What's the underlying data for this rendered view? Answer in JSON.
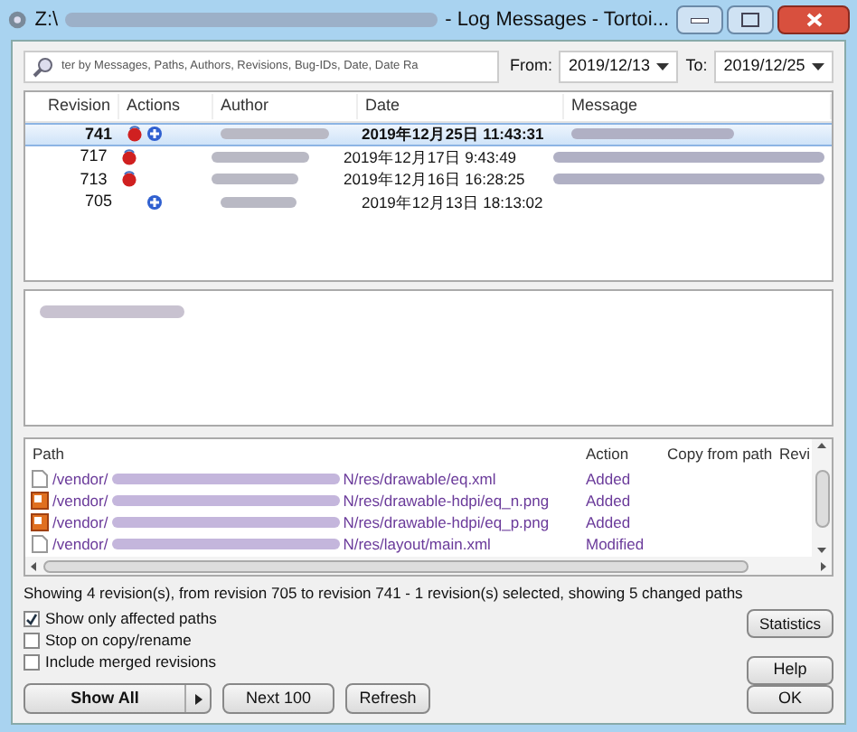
{
  "window": {
    "title_start": "Z:\\",
    "title_end": "- Log Messages - Tortoi..."
  },
  "filter": {
    "placeholder": "ter by Messages, Paths, Authors, Revisions, Bug-IDs, Date, Date Ra"
  },
  "from": {
    "label": "From:",
    "value": "2019/12/13"
  },
  "to": {
    "label": "To:",
    "value": "2019/12/25"
  },
  "revisions": {
    "columns": [
      "Revision",
      "Actions",
      "Author",
      "Date",
      "Message"
    ],
    "rows": [
      {
        "revision": "741",
        "modified": true,
        "added": true,
        "date": "2019年12月25日 11:43:31",
        "selected": true
      },
      {
        "revision": "717",
        "modified": true,
        "added": false,
        "date": "2019年12月17日 9:43:49",
        "selected": false
      },
      {
        "revision": "713",
        "modified": true,
        "added": false,
        "date": "2019年12月16日 16:28:25",
        "selected": false
      },
      {
        "revision": "705",
        "modified": false,
        "added": true,
        "date": "2019年12月13日 18:13:02",
        "selected": false
      }
    ]
  },
  "paths": {
    "columns": [
      "Path",
      "Action",
      "Copy from path",
      "Revi"
    ],
    "rows": [
      {
        "kind": "file",
        "start": "/vendor/",
        "end": "N/res/drawable/eq.xml",
        "action": "Added"
      },
      {
        "kind": "image",
        "start": "/vendor/",
        "end": "N/res/drawable-hdpi/eq_n.png",
        "action": "Added"
      },
      {
        "kind": "image",
        "start": "/vendor/",
        "end": "N/res/drawable-hdpi/eq_p.png",
        "action": "Added"
      },
      {
        "kind": "file",
        "start": "/vendor/",
        "end": "N/res/layout/main.xml",
        "action": "Modified"
      }
    ]
  },
  "status": "Showing 4 revision(s), from revision 705 to revision 741 - 1 revision(s) selected, showing 5 changed paths",
  "options": [
    {
      "label": "Show only affected paths",
      "checked": true
    },
    {
      "label": "Stop on copy/rename",
      "checked": false
    },
    {
      "label": "Include merged revisions",
      "checked": false
    }
  ],
  "buttons": {
    "show_all": "Show All",
    "next": "Next 100",
    "refresh": "Refresh",
    "statistics": "Statistics",
    "help": "Help",
    "ok": "OK"
  }
}
